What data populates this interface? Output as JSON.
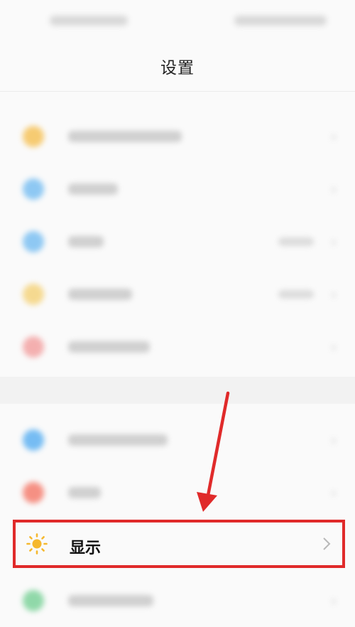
{
  "header": {
    "title": "设置"
  },
  "settings_rows": [
    {
      "label": "",
      "value": "",
      "color": "#f6c35b"
    },
    {
      "label": "",
      "value": "",
      "color": "#7cc0f2"
    },
    {
      "label": "",
      "value": "",
      "color": "#7cc0f2"
    },
    {
      "label": "",
      "value": "",
      "color": "#f5d47e"
    },
    {
      "label": "",
      "value": "",
      "color": "#f3a3a3"
    },
    {
      "label": "",
      "value": "",
      "color": "#5fb2f2"
    },
    {
      "label": "",
      "value": "",
      "color": "#f57e6f"
    }
  ],
  "highlighted_row": {
    "label": "显示",
    "icon": "sun-icon",
    "icon_color": "#f5b82e"
  },
  "bottom_row": {
    "label": "",
    "color": "#7ed39b"
  },
  "annotation": {
    "color": "#e02a2a"
  }
}
